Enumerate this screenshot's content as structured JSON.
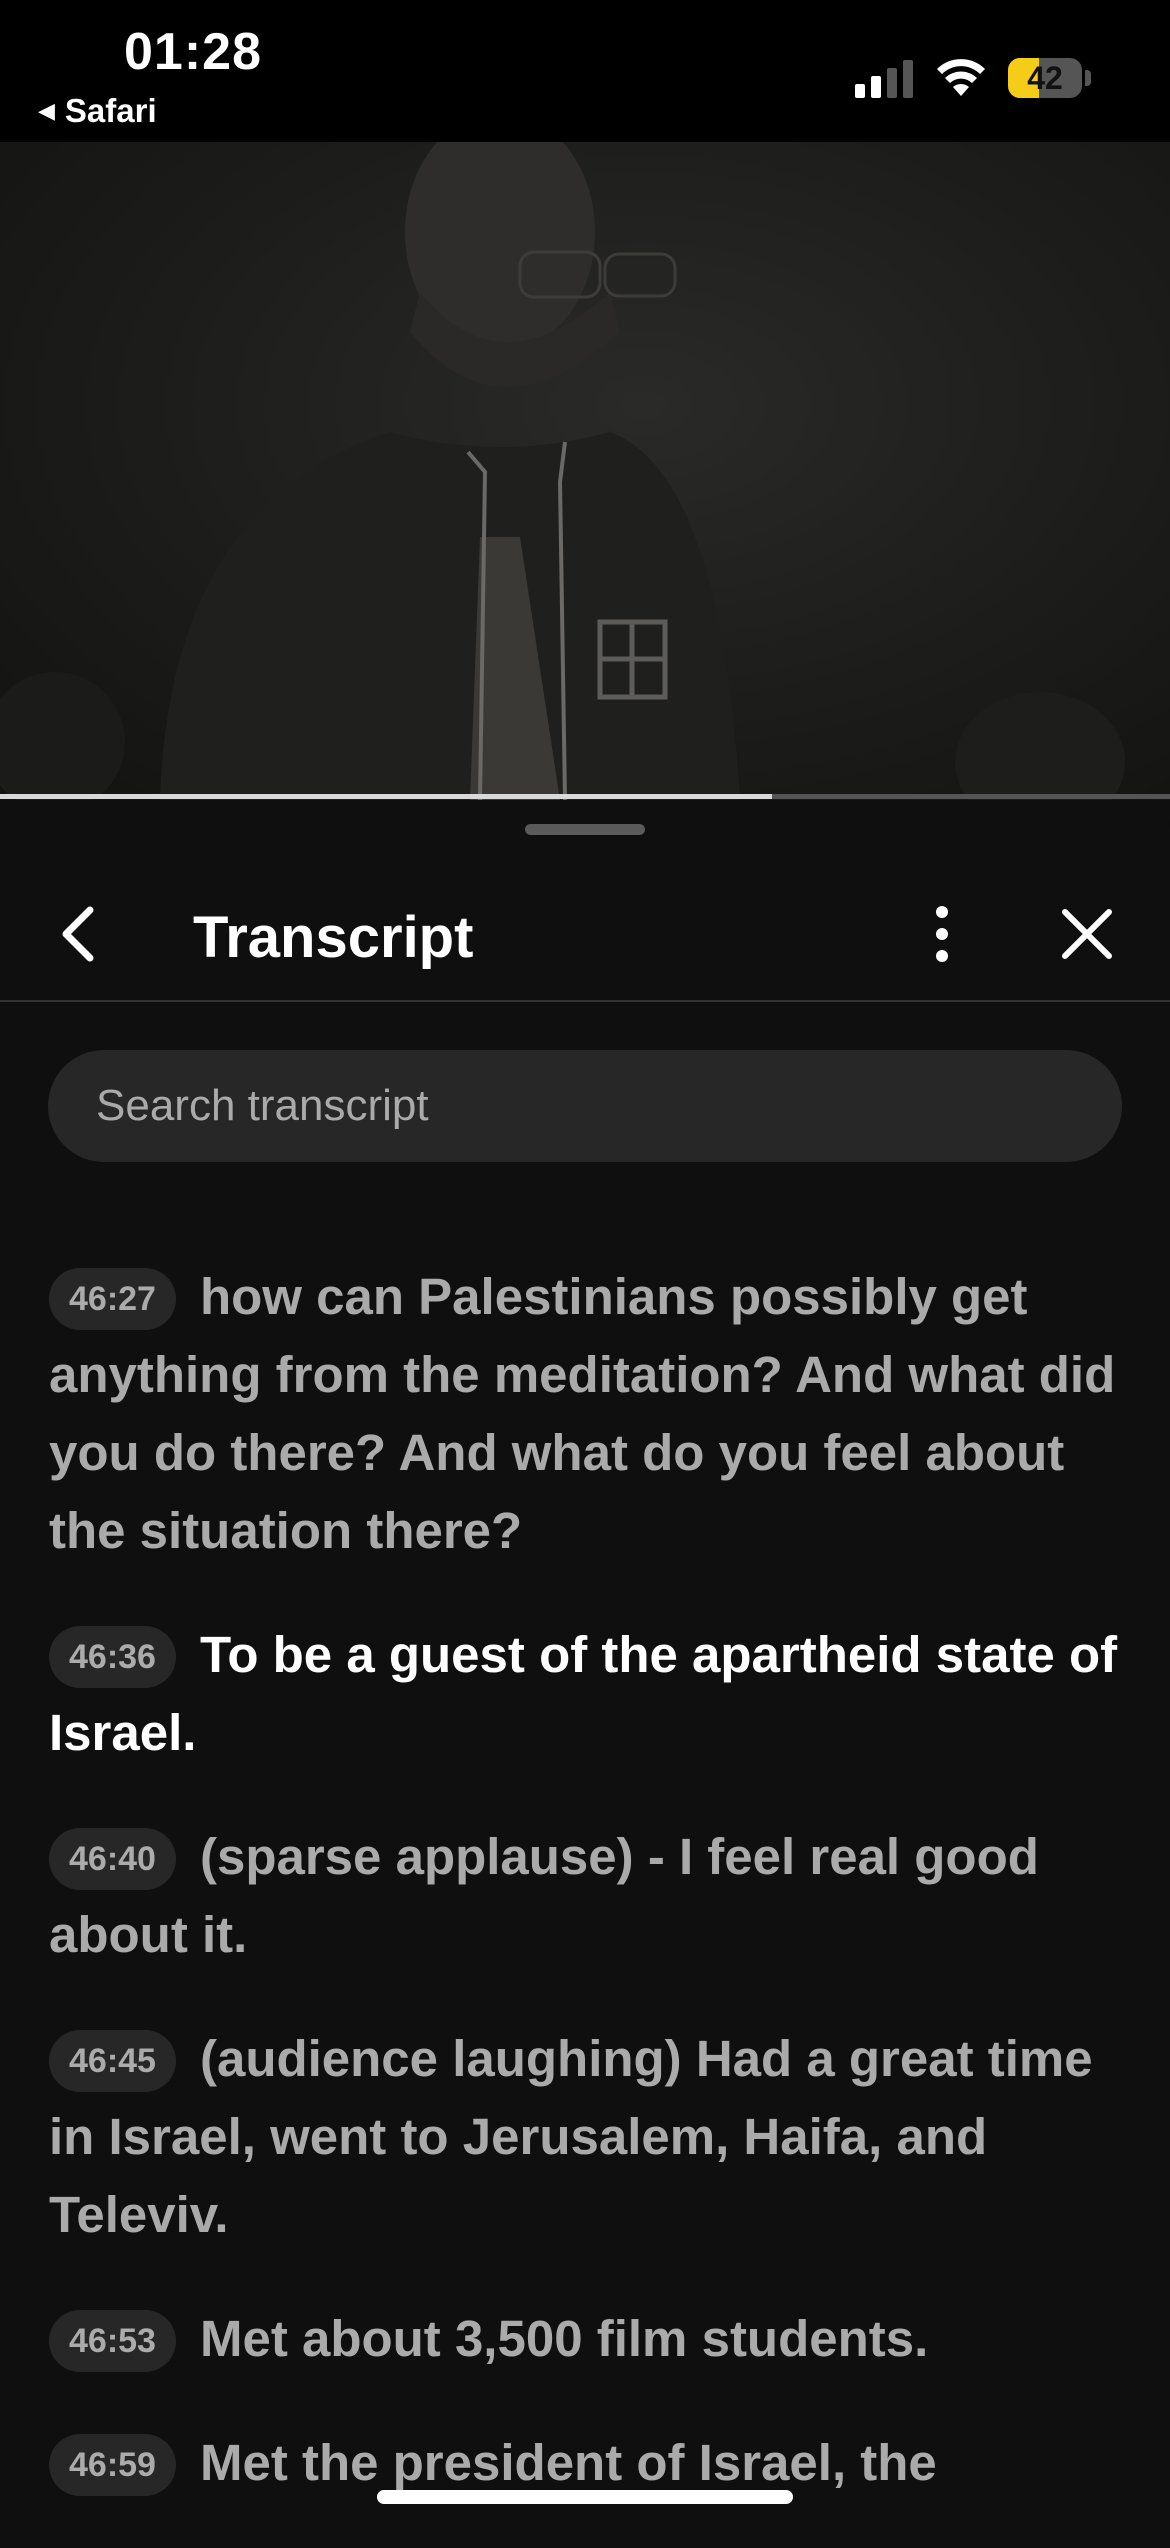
{
  "status_bar": {
    "time": "01:28",
    "back_app": "Safari",
    "battery_percent": 42,
    "battery_label": "42",
    "battery_color": "#f5cc17"
  },
  "video": {
    "progress": 0.66
  },
  "transcript_panel": {
    "title": "Transcript",
    "back_icon": "chevron-left-icon",
    "more_icon": "more-vertical-icon",
    "close_icon": "close-icon",
    "search_placeholder": "Search transcript",
    "search_value": "",
    "segments": [
      {
        "time": "46:27",
        "text": "how can Palestinians possibly get anything from the meditation? And what did you do there? And what do you feel about the situation there?",
        "active": false
      },
      {
        "time": "46:36",
        "text": "To be a guest of the apartheid state of Israel.",
        "active": true
      },
      {
        "time": "46:40",
        "text": "(sparse applause) - I feel real good about it.",
        "active": false
      },
      {
        "time": "46:45",
        "text": "(audience laughing) Had a great time in Israel, went to Jerusalem, Haifa, and Televiv.",
        "active": false
      },
      {
        "time": "46:53",
        "text": "Met about 3,500 film students.",
        "active": false
      },
      {
        "time": "46:59",
        "text": "Met the president of Israel, the",
        "active": false
      }
    ]
  }
}
